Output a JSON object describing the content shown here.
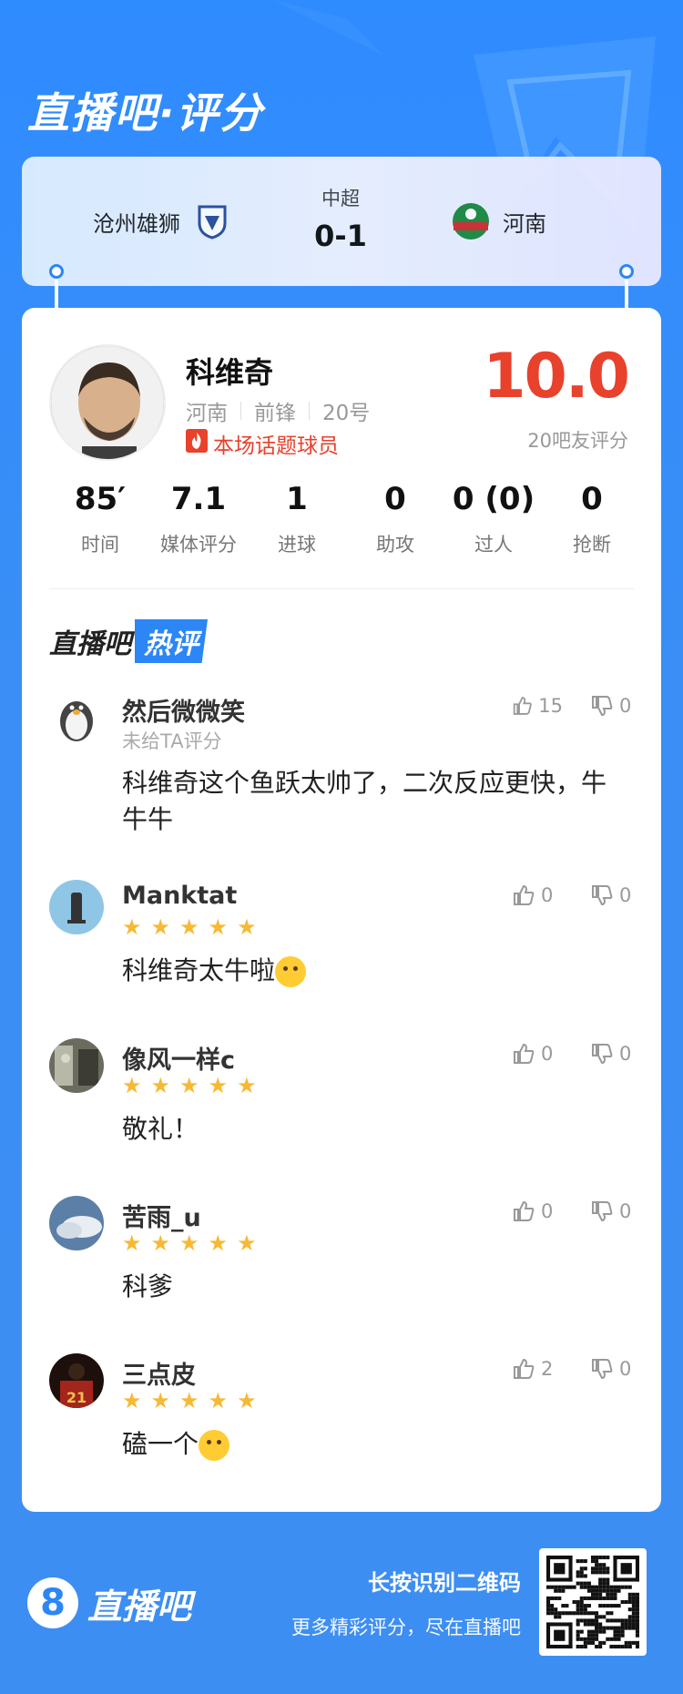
{
  "header": {
    "title": "直播吧·评分"
  },
  "match": {
    "home_team": "沧州雄狮",
    "away_team": "河南",
    "league": "中超",
    "score": "0-1"
  },
  "player": {
    "name": "科维奇",
    "team": "河南",
    "position": "前锋",
    "number": "20号",
    "tag": "本场话题球员",
    "rating": "10.0",
    "rating_sub": "20吧友评分",
    "stats": [
      {
        "value": "85′",
        "label": "时间"
      },
      {
        "value": "7.1",
        "label": "媒体评分"
      },
      {
        "value": "1",
        "label": "进球"
      },
      {
        "value": "0",
        "label": "助攻"
      },
      {
        "value": "0 (0)",
        "label": "过人"
      },
      {
        "value": "0",
        "label": "抢断"
      }
    ]
  },
  "hot_comments": {
    "title_a": "直播吧",
    "title_b": "热评",
    "items": [
      {
        "user": "然后微微笑",
        "sub": "未给TA评分",
        "stars": 0,
        "text": "科维奇这个鱼跃太帅了，二次反应更快，牛牛牛",
        "likes": "15",
        "dislikes": "0"
      },
      {
        "user": "Manktat",
        "sub": "",
        "stars": 5,
        "text": "科维奇太牛啦",
        "likes": "0",
        "dislikes": "0"
      },
      {
        "user": "像风一样c",
        "sub": "",
        "stars": 5,
        "text": "敬礼！",
        "likes": "0",
        "dislikes": "0"
      },
      {
        "user": "苦雨_u",
        "sub": "",
        "stars": 5,
        "text": "科爹",
        "likes": "0",
        "dislikes": "0"
      },
      {
        "user": "三点皮",
        "sub": "",
        "stars": 5,
        "text": "磕一个",
        "likes": "2",
        "dislikes": "0"
      }
    ]
  },
  "footer": {
    "logo_digit": "8",
    "logo_text": "直播吧",
    "cta_main": "长按识别二维码",
    "cta_sub": "更多精彩评分，尽在直播吧"
  },
  "colors": {
    "accent": "#2c86f5",
    "rating": "#e8412c",
    "star": "#f7b934"
  }
}
